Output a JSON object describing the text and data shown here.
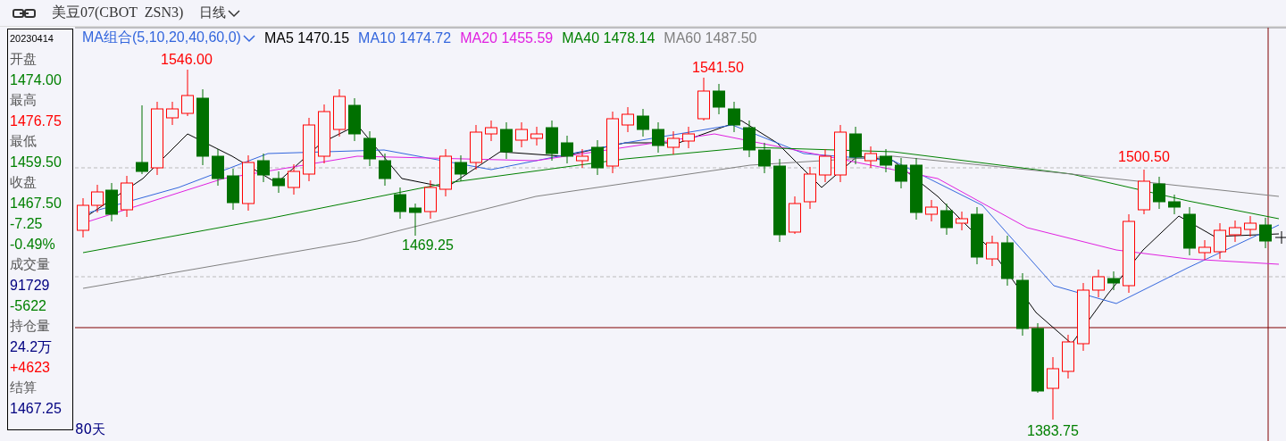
{
  "title_bar": {
    "instrument": "美豆07(CBOT  ZSN3)",
    "period": "日线"
  },
  "info_panel": {
    "date": "20230414",
    "fields": [
      {
        "label": "开盘",
        "values": [
          {
            "text": "1474.00",
            "color": "#008000"
          }
        ]
      },
      {
        "label": "最高",
        "values": [
          {
            "text": "1476.75",
            "color": "#ff0000"
          }
        ]
      },
      {
        "label": "最低",
        "values": [
          {
            "text": "1459.50",
            "color": "#008000"
          }
        ]
      },
      {
        "label": "收盘",
        "values": [
          {
            "text": "1467.50",
            "color": "#008000"
          },
          {
            "text": "-7.25",
            "color": "#008000"
          },
          {
            "text": "-0.49%",
            "color": "#008000"
          }
        ]
      },
      {
        "label": "成交量",
        "values": [
          {
            "text": "91729",
            "color": "#000080"
          },
          {
            "text": "-5622",
            "color": "#008000"
          }
        ]
      },
      {
        "label": "持仓量",
        "values": [
          {
            "text": "24.2万",
            "color": "#000080"
          },
          {
            "text": "+4623",
            "color": "#ff0000"
          }
        ]
      },
      {
        "label": "结算",
        "values": [
          {
            "text": "1467.25",
            "color": "#000080"
          }
        ]
      }
    ]
  },
  "legend": {
    "group": "MA组合(5,10,20,40,60,0)",
    "items": [
      {
        "name": "MA5",
        "value": "1470.15",
        "color": "#000000"
      },
      {
        "name": "MA10",
        "value": "1474.72",
        "color": "#3366dd"
      },
      {
        "name": "MA20",
        "value": "1455.59",
        "color": "#e020e0"
      },
      {
        "name": "MA40",
        "value": "1478.14",
        "color": "#008000"
      },
      {
        "name": "MA60",
        "value": "1487.50",
        "color": "#808080"
      }
    ]
  },
  "annotations": [
    {
      "text": "1546.00",
      "kind": "high"
    },
    {
      "text": "1541.50",
      "kind": "high"
    },
    {
      "text": "1500.50",
      "kind": "high"
    },
    {
      "text": "1469.25",
      "kind": "low"
    },
    {
      "text": "1383.75",
      "kind": "low"
    }
  ],
  "footer": {
    "range": "80天"
  }
}
